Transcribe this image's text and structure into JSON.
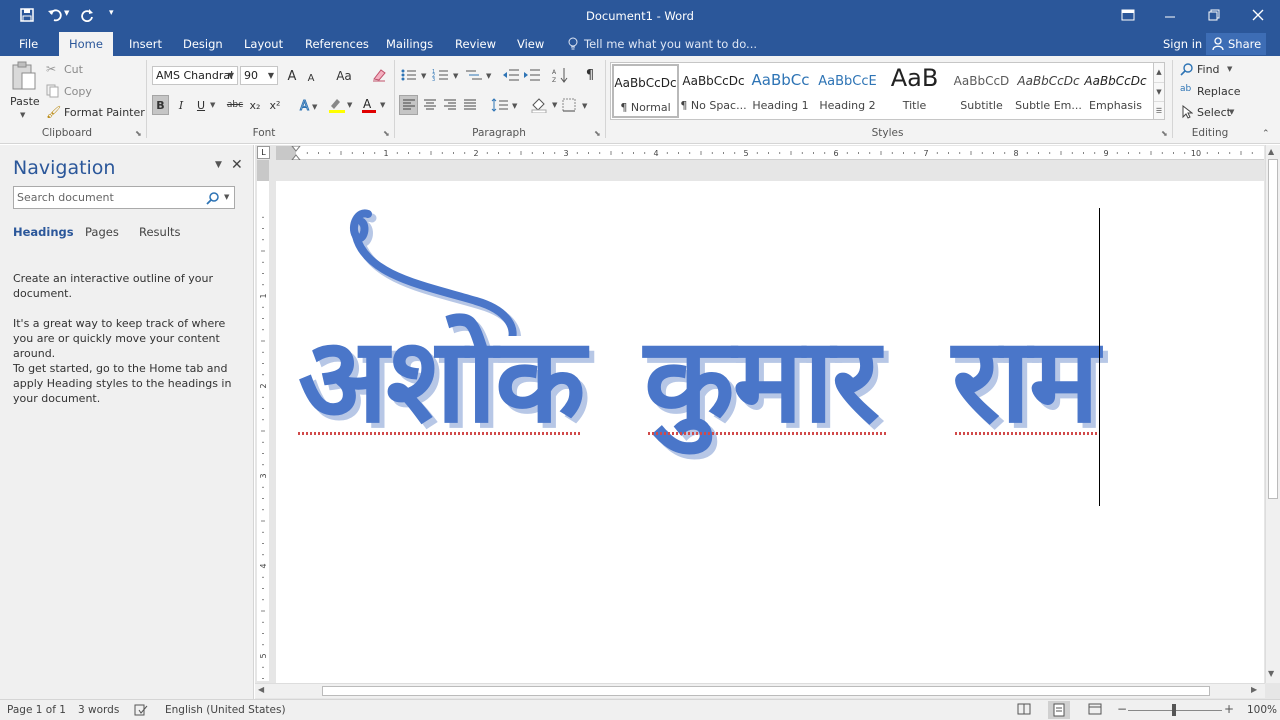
{
  "window": {
    "title": "Document1 - Word"
  },
  "qat": {
    "save": "save-icon",
    "undo": "undo-icon",
    "redo": "redo-icon",
    "customize": "customize-icon"
  },
  "tabs": [
    "File",
    "Home",
    "Insert",
    "Design",
    "Layout",
    "References",
    "Mailings",
    "Review",
    "View"
  ],
  "tell_me": "Tell me what you want to do...",
  "account": {
    "signin": "Sign in",
    "share": "Share"
  },
  "clipboard": {
    "paste": "Paste",
    "cut": "Cut",
    "copy": "Copy",
    "format_painter": "Format Painter",
    "label": "Clipboard"
  },
  "font": {
    "name": "AMS Chandral",
    "size": "90",
    "label": "Font",
    "bold": "B",
    "italic": "I",
    "underline": "U",
    "strike": "abc",
    "sub": "x₂",
    "sup": "x²",
    "grow": "A",
    "shrink": "A",
    "case": "Aa"
  },
  "paragraph": {
    "label": "Paragraph"
  },
  "styles": {
    "label": "Styles",
    "items": [
      {
        "preview": "AaBbCcDc",
        "label": "¶ Normal",
        "color": "#222222"
      },
      {
        "preview": "AaBbCcDc",
        "label": "¶ No Spac...",
        "color": "#222222"
      },
      {
        "preview": "AaBbCc",
        "label": "Heading 1",
        "color": "#2e74b5"
      },
      {
        "preview": "AaBbCcE",
        "label": "Heading 2",
        "color": "#2e74b5"
      },
      {
        "preview": "AaB",
        "label": "Title",
        "color": "#222222"
      },
      {
        "preview": "AaBbCcD",
        "label": "Subtitle",
        "color": "#5a5a5a"
      },
      {
        "preview": "AaBbCcDc",
        "label": "Subtle Em...",
        "color": "#404040"
      },
      {
        "preview": "AaBbCcDc",
        "label": "Emphasis",
        "color": "#222222"
      }
    ]
  },
  "editing": {
    "find": "Find",
    "replace": "Replace",
    "select": "Select",
    "label": "Editing"
  },
  "navigation": {
    "title": "Navigation",
    "search_placeholder": "Search document",
    "tabs": [
      "Headings",
      "Pages",
      "Results"
    ],
    "paragraphs": [
      "Create an interactive outline of your document.",
      "It's a great way to keep track of where you are or quickly move your content around.",
      "To get started, go to the Home tab and apply Heading styles to the headings in your document."
    ]
  },
  "ruler": {
    "h_numbers": [
      "1",
      "1",
      "2",
      "3",
      "4",
      "5",
      "6",
      "7",
      "8",
      "9",
      "10"
    ],
    "v_numbers": [
      "1",
      "2",
      "3",
      "4",
      "5"
    ]
  },
  "document": {
    "words": [
      "अशोक",
      "कुमार",
      "राम"
    ],
    "text_color": "#4a76c9"
  },
  "status": {
    "page": "Page 1 of 1",
    "words": "3 words",
    "language": "English (United States)",
    "zoom": "100%"
  }
}
